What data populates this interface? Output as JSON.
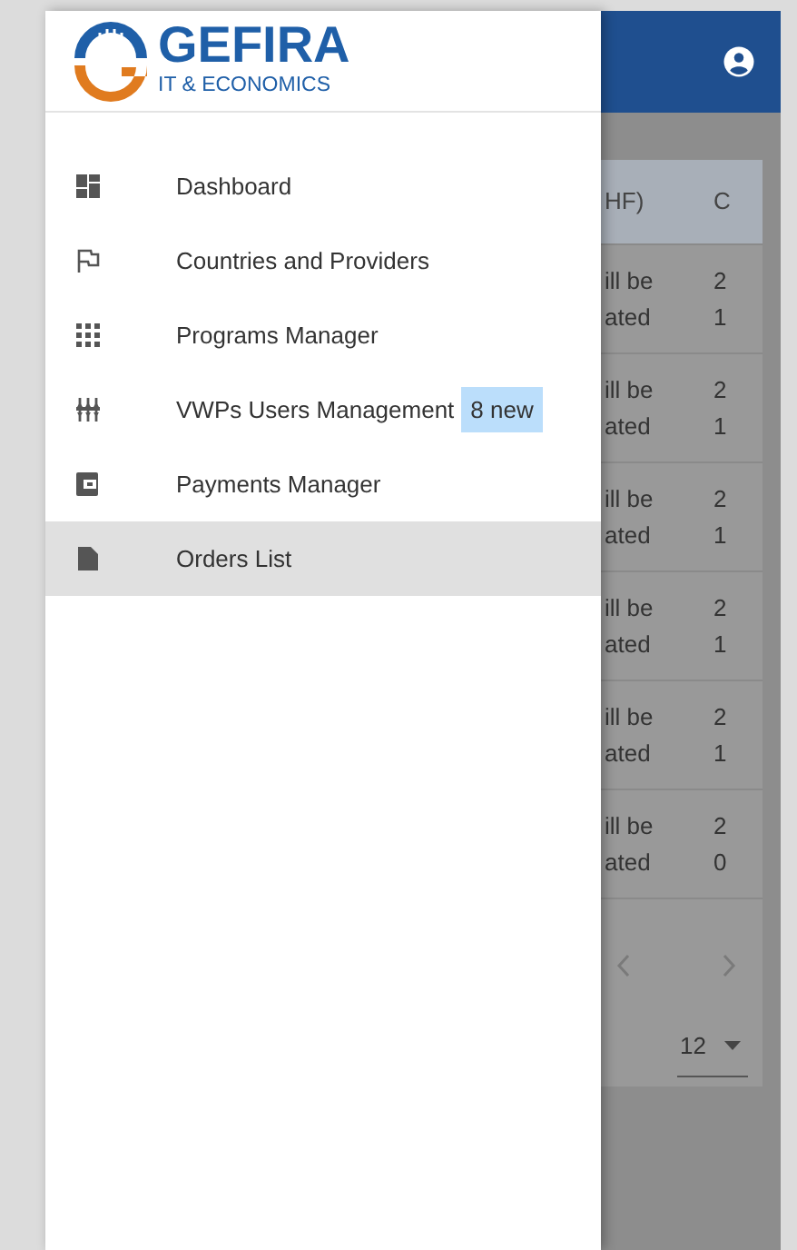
{
  "logo": {
    "name": "GEFIRA",
    "tagline": "IT & ECONOMICS"
  },
  "menu": [
    {
      "label": "Dashboard",
      "kind": "dashboard",
      "selected": false
    },
    {
      "label": "Countries and Providers",
      "kind": "flag",
      "selected": false
    },
    {
      "label": "Programs Manager",
      "kind": "apps",
      "selected": false
    },
    {
      "label": "VWPs Users Management",
      "kind": "sliders",
      "selected": false,
      "badge": "8 new"
    },
    {
      "label": "Payments Manager",
      "kind": "wallet",
      "selected": false
    },
    {
      "label": "Orders List",
      "kind": "document",
      "selected": true
    }
  ],
  "table": {
    "columns": [
      "HF)",
      "C"
    ],
    "rows": [
      {
        "cells": [
          [
            "ill be",
            "ated"
          ],
          [
            "2",
            "1"
          ]
        ]
      },
      {
        "cells": [
          [
            "ill be",
            "ated"
          ],
          [
            "2",
            "1"
          ]
        ]
      },
      {
        "cells": [
          [
            "ill be",
            "ated"
          ],
          [
            "2",
            "1"
          ]
        ]
      },
      {
        "cells": [
          [
            "ill be",
            "ated"
          ],
          [
            "2",
            "1"
          ]
        ]
      },
      {
        "cells": [
          [
            "ill be",
            "ated"
          ],
          [
            "2",
            "1"
          ]
        ]
      },
      {
        "cells": [
          [
            "ill be",
            "ated"
          ],
          [
            "2",
            "0"
          ]
        ]
      }
    ]
  },
  "pagination": {
    "page_size": "12"
  }
}
